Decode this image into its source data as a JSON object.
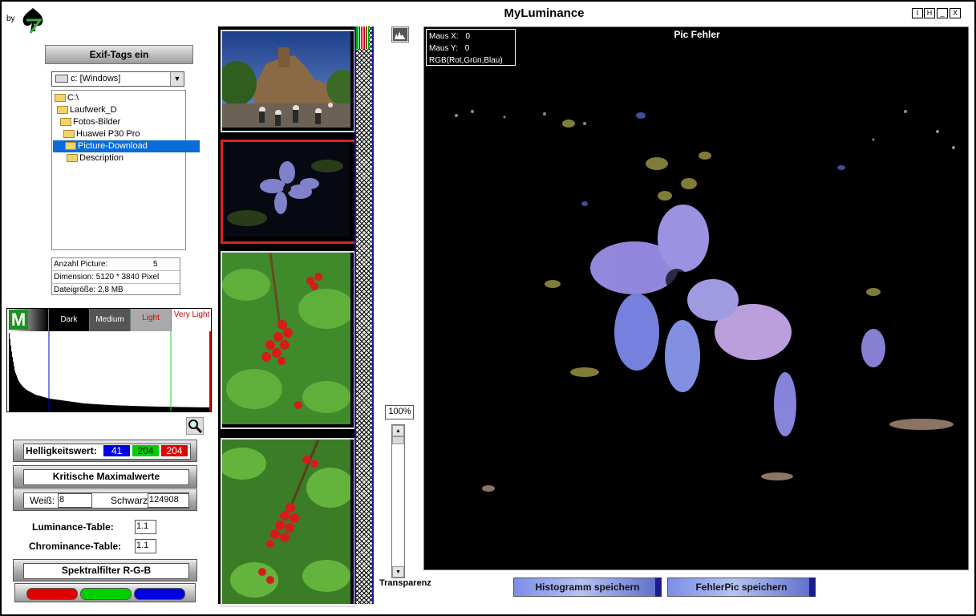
{
  "window": {
    "title": "MyLuminance",
    "controls": [
      "I",
      "H",
      "_",
      "X"
    ],
    "by": "by"
  },
  "exif_button": "Exif-Tags ein",
  "drive": {
    "selected": "c: [Windows]"
  },
  "folders": [
    {
      "label": "C:\\",
      "indent": 0
    },
    {
      "label": "Laufwerk_D",
      "indent": 0
    },
    {
      "label": "Fotos-Bilder",
      "indent": 1
    },
    {
      "label": "Huawei P30 Pro",
      "indent": 2
    },
    {
      "label": "Picture-Download",
      "indent": 2,
      "selected": true
    },
    {
      "label": "Description",
      "indent": 3
    }
  ],
  "info": {
    "count_label": "Anzahl Picture:",
    "count_value": "5",
    "dimension": "Dimension: 5120 * 3840 Pixel",
    "filesize": "Dateigröße: 2,8 MB"
  },
  "histogram": {
    "labels": {
      "m": "M",
      "dark": "Dark",
      "medium": "Medium",
      "light": "Light",
      "very_light": "Very Light"
    },
    "colors": {
      "dark_line": "#0000cc",
      "light_line": "#22cc22",
      "end_line": "#cc0000"
    },
    "profile": [
      0.98,
      0.7,
      0.5,
      0.4,
      0.34,
      0.3,
      0.27,
      0.25,
      0.23,
      0.21,
      0.2,
      0.19,
      0.18,
      0.17,
      0.16,
      0.155,
      0.15,
      0.145,
      0.14,
      0.135,
      0.13,
      0.125,
      0.12,
      0.115,
      0.11,
      0.105,
      0.1,
      0.098,
      0.095,
      0.093,
      0.09,
      0.088,
      0.086,
      0.084,
      0.082,
      0.08,
      0.078,
      0.076,
      0.075,
      0.074,
      0.073,
      0.072,
      0.07,
      0.069,
      0.068,
      0.067,
      0.066,
      0.065,
      0.064,
      0.063,
      0.062,
      0.061,
      0.06,
      0.06,
      0.059,
      0.058,
      0.058,
      0.057,
      0.056,
      0.056,
      0.055,
      0.055,
      0.054,
      0.054,
      0.053,
      0.053,
      0.052,
      0.052,
      0.052,
      0.051
    ]
  },
  "magnifier": "magnifier-icon",
  "helligkeit": {
    "label": "Helligkeitswert:",
    "blue": "41",
    "green": "204",
    "red": "204"
  },
  "kritische": "Kritische Maximalwerte",
  "weiss": {
    "label": "Weiß:",
    "value": "8"
  },
  "schwarz": {
    "label": "Schwarz:",
    "value": "124908"
  },
  "luminance": {
    "label": "Luminance-Table:",
    "value": "1.1"
  },
  "chrominance": {
    "label": "Chrominance-Table:",
    "value": "1.1"
  },
  "spektral": "Spektralfilter R-G-B",
  "rgb_buttons": [
    "#e00000",
    "#00d000",
    "#0000e0"
  ],
  "thumbnails": [
    {
      "name": "castle-photo"
    },
    {
      "name": "flower-photo",
      "selected": true
    },
    {
      "name": "currant-photo-1"
    },
    {
      "name": "currant-photo-2"
    }
  ],
  "histogram_toggle": "histogram-icon",
  "zoom": "100%",
  "transparenz": "Transparenz",
  "preview": {
    "title": "Pic Fehler",
    "maus_x_label": "Maus X:",
    "maus_x": "0",
    "maus_y_label": "Maus Y:",
    "maus_y": "0",
    "rgb_label": "RGB(Rot,Grün,Blau)"
  },
  "buttons": {
    "save_histogram": "Histogramm speichern",
    "save_fehlerpic": "FehlerPic speichern"
  }
}
